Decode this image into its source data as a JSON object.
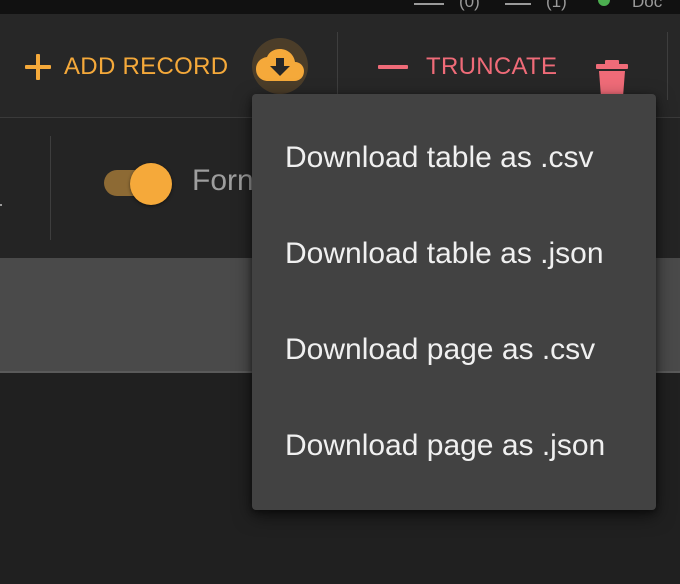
{
  "status_bar": {
    "count_a": "(0)",
    "count_b": "(1)",
    "label": "Doc"
  },
  "toolbar": {
    "add_record_label": "ADD RECORD",
    "truncate_label": "TRUNCATE",
    "download_icon": "cloud-download-icon",
    "delete_icon": "trash-icon"
  },
  "options": {
    "format_toggle_label": "Forn",
    "format_toggle_on": true
  },
  "download_menu": {
    "items": [
      "Download table as .csv",
      "Download table as .json",
      "Download page as .csv",
      "Download page as .json"
    ]
  },
  "colors": {
    "accent": "#f5a93a",
    "danger": "#ef6b78",
    "menu_bg": "#424242",
    "background": "#202020"
  }
}
